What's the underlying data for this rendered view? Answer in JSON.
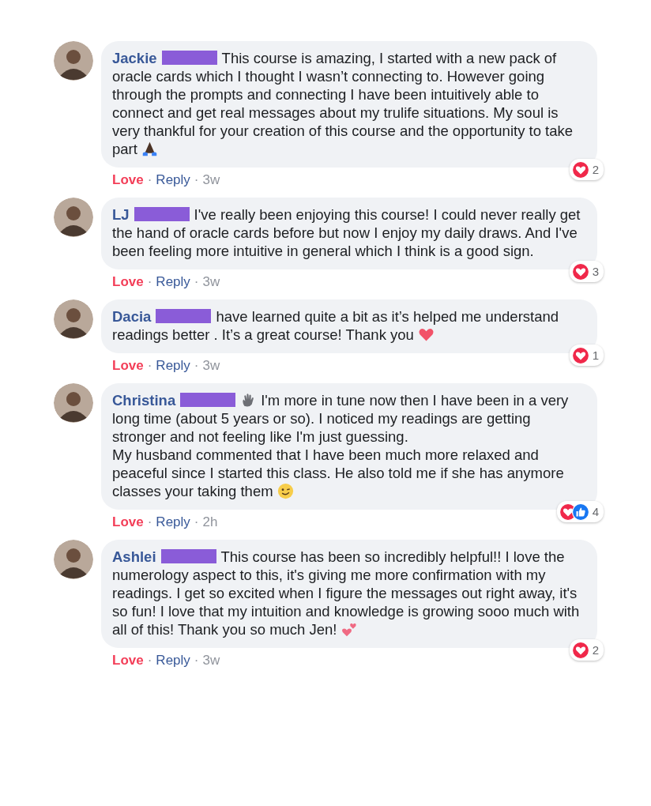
{
  "comments": [
    {
      "author": "Jackie",
      "text": "This course is amazing, I started with a new pack of oracle cards which I thought I wasn’t connecting to. However going through the prompts and connecting I have been intuitively able to connect and get real messages about my trulife situations. My soul is very thankful for your creation of this course and the opportunity to take part",
      "emojis_after": [
        {
          "kind": "pray"
        }
      ],
      "reactions": [
        {
          "kind": "love"
        }
      ],
      "reaction_count": "2",
      "loved": true,
      "love_label": "Love",
      "separator_1": "·",
      "reply_label": "Reply",
      "separator_2": "·",
      "time": "3w"
    },
    {
      "author": "LJ",
      "text": "I've really been enjoying this course! I could never really get the hand of oracle cards before but now I enjoy my daily draws. And I've been feeling more intuitive in general which I think is a good sign.",
      "reactions": [
        {
          "kind": "love"
        }
      ],
      "reaction_count": "3",
      "loved": true,
      "love_label": "Love",
      "separator_1": "·",
      "reply_label": "Reply",
      "separator_2": "·",
      "time": "3w"
    },
    {
      "author": "Dacia",
      "text": "have learned quite a bit as it’s helped me understand readings better . It’s a great course! Thank you",
      "emojis_after": [
        {
          "kind": "heart"
        }
      ],
      "reactions": [
        {
          "kind": "love"
        }
      ],
      "reaction_count": "1",
      "loved": true,
      "love_label": "Love",
      "separator_1": "·",
      "reply_label": "Reply",
      "separator_2": "·",
      "time": "3w"
    },
    {
      "author": "Christina",
      "emojis_before": [
        {
          "kind": "wave"
        }
      ],
      "text": "I'm more in tune now then I have been in a very long time (about 5 years or so). I noticed my readings are getting stronger and not feeling like I'm just guessing.\nMy husband commented that I have been much more relaxed and peaceful since I started this class. He also told me if she has anymore classes your taking them",
      "emojis_after": [
        {
          "kind": "wink"
        }
      ],
      "reactions": [
        {
          "kind": "love"
        },
        {
          "kind": "like"
        }
      ],
      "reaction_count": "4",
      "loved": true,
      "love_label": "Love",
      "separator_1": "·",
      "reply_label": "Reply",
      "separator_2": "·",
      "time": "2h"
    },
    {
      "author": "Ashlei",
      "text": "This course has been so incredibly helpful!! I love the numerology aspect to this, it's giving me more confirmation with my readings. I get so excited when I figure the messages out right away, it's so fun! I love that my intuition and knowledge is growing sooo much with all of this! Thank you so much Jen!",
      "emojis_after": [
        {
          "kind": "two-hearts"
        }
      ],
      "reactions": [
        {
          "kind": "love"
        }
      ],
      "reaction_count": "2",
      "loved": true,
      "love_label": "Love",
      "separator_1": "·",
      "reply_label": "Reply",
      "separator_2": "·",
      "time": "3w"
    }
  ]
}
